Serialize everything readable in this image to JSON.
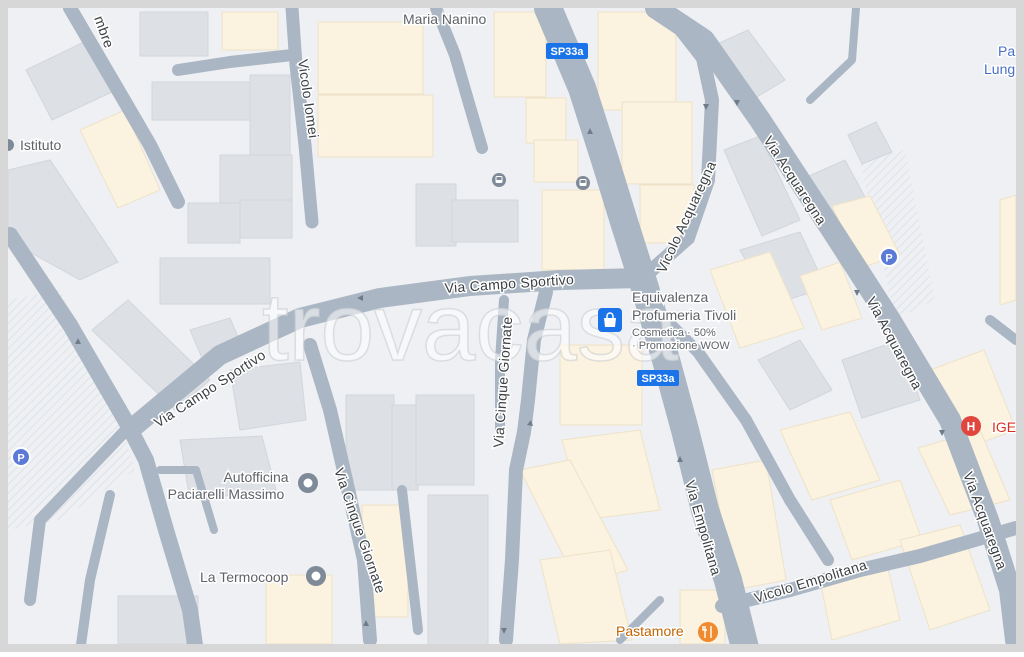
{
  "map": {
    "watermark": "trovacasa",
    "colors": {
      "background": "#eef0f3",
      "road": "#aab6c3",
      "building_beige": "#fbf3e2",
      "building_grey": "#dcdfe4",
      "route_shield": "#1a73e8",
      "poi_grey": "#7e8a97",
      "parking": "#5b7ad8",
      "hospital": "#e0453e",
      "restaurant": "#ef8a2f"
    },
    "roads": [
      {
        "label": "Via Campo Sportivo"
      },
      {
        "label": "Via Campo Sportivo"
      },
      {
        "label": "Vicolo Acquaregna"
      },
      {
        "label": "Via Acquaregna"
      },
      {
        "label": "Via Acquaregna"
      },
      {
        "label": "Via Acquaregna"
      },
      {
        "label": "Via Cinque Giornate"
      },
      {
        "label": "Via Cinque Giornate"
      },
      {
        "label": "Via Empolitana"
      },
      {
        "label": "Vicolo Empolitana"
      },
      {
        "label": "Vicolo Iomei"
      },
      {
        "label": "mbre"
      }
    ],
    "shields": [
      {
        "label": "SP33a"
      },
      {
        "label": "SP33a"
      }
    ],
    "places": {
      "maria_nanino": "Maria Nanino",
      "istituto": "Istituto",
      "pa_lung": [
        "Pa",
        "Lung"
      ],
      "autofficina": [
        "Autofficina",
        "Paciarelli Massimo"
      ],
      "termocoop": "La Termocoop",
      "equivalenza": {
        "name": [
          "Equivalenza",
          "Profumeria Tivoli"
        ],
        "desc": [
          "Cosmetica · 50%",
          "· Promozione WOW"
        ]
      },
      "pastamore": "Pastamore",
      "ige": "IGE"
    },
    "icons": {
      "parking": "P",
      "hospital": "H"
    }
  }
}
